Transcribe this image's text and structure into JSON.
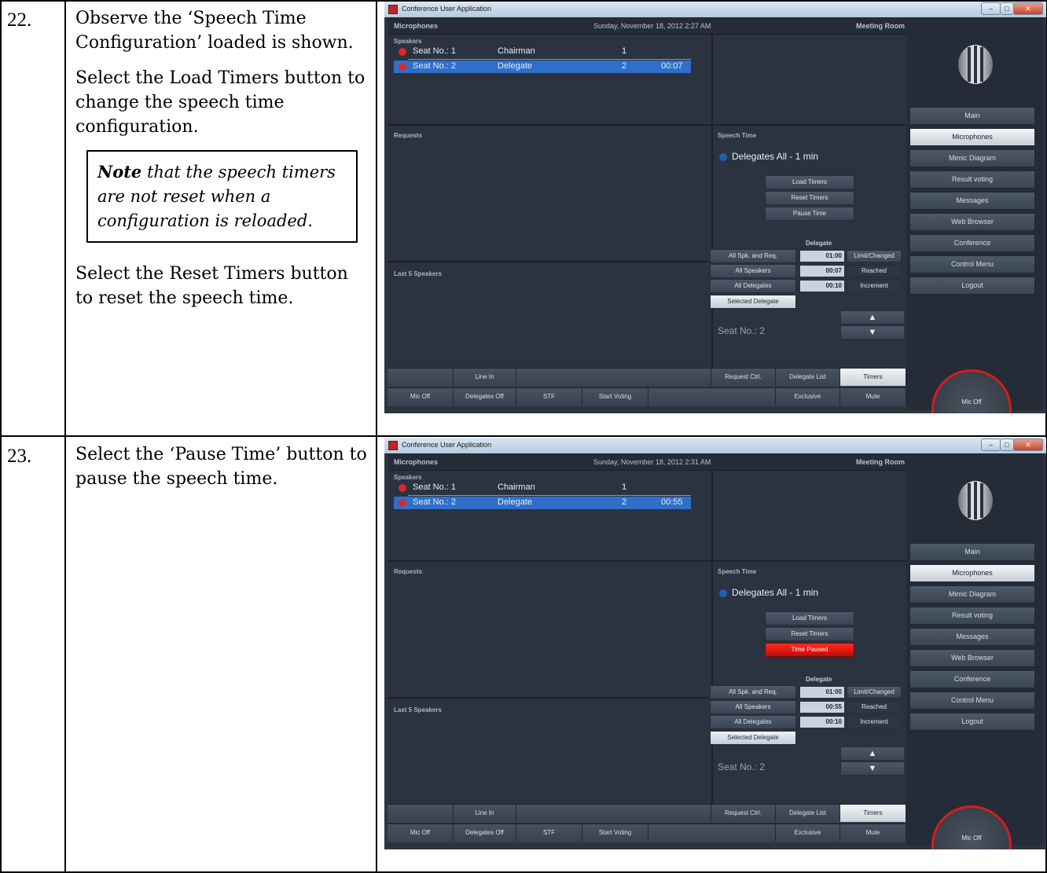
{
  "steps": [
    {
      "number": "22.",
      "paragraphs": [
        "Observe the ‘Speech Time Configuration’ loaded is shown.",
        "Select the Load Timers button to change the speech time configuration."
      ],
      "note": {
        "bold": "Note",
        "rest": " that the speech timers are not reset when a configuration is reloaded",
        "tail": "."
      },
      "after_note": "Select the Reset Timers button to reset the speech time.",
      "screen": {
        "datetime": "Sunday, November 18, 2012 2:27 AM",
        "delegate_time": "00:07",
        "pause_label": "Pause Time",
        "reached": "00:07"
      }
    },
    {
      "number": "23.",
      "paragraphs": [
        "Select the ‘Pause Time’ button to pause the speech time."
      ],
      "screen": {
        "datetime": "Sunday, November 18, 2012 2:31 AM",
        "delegate_time": "00:55",
        "pause_label": "Time Paused",
        "reached": "00:55"
      }
    }
  ],
  "app": {
    "window_title": "Conference User Application",
    "header_left": "Microphones",
    "header_right": "Meeting Room",
    "speakers_label": "Speakers",
    "speakers": [
      {
        "seat": "Seat No.: 1",
        "role": "Chairman",
        "num": "1"
      },
      {
        "seat": "Seat No.: 2",
        "role": "Delegate",
        "num": "2"
      }
    ],
    "requests_label": "Requests",
    "last5_label": "Last 5 Speakers",
    "speech_time_label": "Speech Time",
    "speech_config": "Delegates All - 1 min",
    "load_timers": "Load Timers",
    "reset_timers": "Reset Timers",
    "delegate_header": "Delegate",
    "timer_rows": [
      {
        "button": "All Spk. and Req.",
        "label": "Limit/Changed"
      },
      {
        "button": "All Speakers",
        "label": "Reached"
      },
      {
        "button": "All Delegates",
        "label": "Increment"
      }
    ],
    "limit_value": "01:00",
    "increment_value": "00:10",
    "selected_delegate": "Selected Delegate",
    "selected_seat": "Seat No.: 2",
    "arrow_up": "▲",
    "arrow_down": "▼",
    "bottom_row1": [
      "Line In",
      "Request Ctrl.",
      "Delegate List",
      "Timers"
    ],
    "bottom_row2": [
      "Mic Off",
      "Delegates Off",
      "STF",
      "Start Voting",
      "Exclusive",
      "Mute"
    ],
    "side_menu": [
      "Main",
      "Microphones",
      "Mimic Diagram",
      "Result voting",
      "Messages",
      "Web Browser",
      "Conference",
      "Control Menu",
      "Logout"
    ],
    "mic_off_round": "Mic Off"
  }
}
